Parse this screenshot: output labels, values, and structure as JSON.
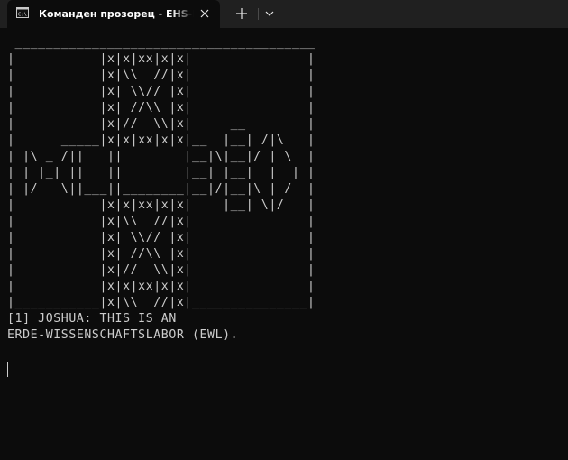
{
  "tab": {
    "title": "Команден прозорец - EHS-Fi",
    "icon": "command-prompt-icon"
  },
  "titlebar": {
    "close_icon": "close-icon",
    "new_tab_icon": "plus-icon",
    "dropdown_icon": "chevron-down-icon"
  },
  "console": {
    "output": " _______________________________________\n|           |x|x|xx|x|x|               |\n|           |x|\\\\  //|x|               |\n|           |x| \\\\// |x|               |\n|           |x| //\\\\ |x|               |\n|           |x|//  \\\\|x|     __        |\n|      _____|x|x|xx|x|x|__  |__| /|\\   |\n| |\\ _ /||   ||        |__|\\|__|/ | \\  |\n| | |_| ||   ||        |__| |__|  |  | |\n| |/   \\||___||________|__|/|__|\\ | /  |\n|           |x|x|xx|x|x|    |__| \\|/   |\n|           |x|\\\\  //|x|               |\n|           |x| \\\\// |x|               |\n|           |x| //\\\\ |x|               |\n|           |x|//  \\\\|x|               |\n|           |x|x|xx|x|x|               |\n|___________|x|\\\\  //|x|_______________|\n[1] JOSHUA: THIS IS AN\nERDE-WISSENSCHAFTSLABOR (EWL).",
    "background": "#0c0c0c",
    "foreground": "#cccccc"
  },
  "colors": {
    "titlebar_bg": "#202020",
    "tab_active_bg": "#0c0c0c",
    "text": "#ffffff"
  }
}
